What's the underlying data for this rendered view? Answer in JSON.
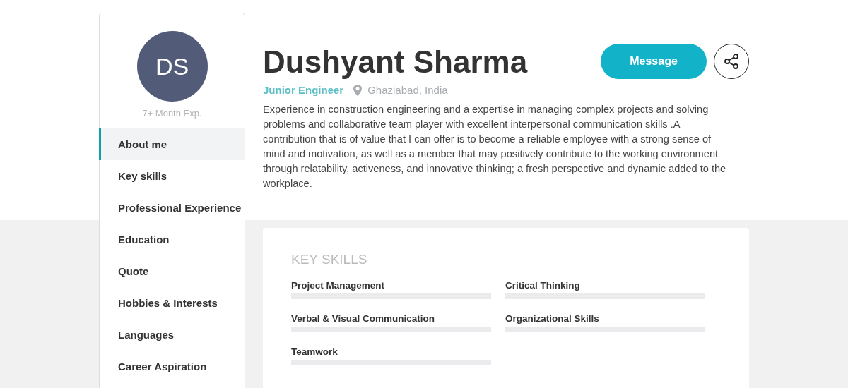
{
  "profile": {
    "initials": "DS",
    "experience": "7+ Month Exp.",
    "name": "Dushyant Sharma",
    "role": "Junior Engineer",
    "location": "Ghaziabad, India",
    "bio": "Experience in construction engineering and a expertise in managing complex projects and solving problems and collaborative team player with excellent interpersonal communication skills .A contribution that is of value that I can offer is to become a reliable employee with a strong sense of mind and motivation, as well as a member that may positively contribute to the working environment through relatability, activeness, and innovative thinking; a fresh perspective and dynamic added to the workplace."
  },
  "actions": {
    "message": "Message"
  },
  "sidebar": {
    "items": [
      {
        "label": "About me",
        "selected": true
      },
      {
        "label": "Key skills",
        "selected": false
      },
      {
        "label": "Professional Experience",
        "selected": false
      },
      {
        "label": "Education",
        "selected": false
      },
      {
        "label": "Quote",
        "selected": false
      },
      {
        "label": "Hobbies & Interests",
        "selected": false
      },
      {
        "label": "Languages",
        "selected": false
      },
      {
        "label": "Career Aspiration",
        "selected": false
      }
    ]
  },
  "key_skills": {
    "title": "KEY SKILLS",
    "skills": [
      {
        "name": "Project Management"
      },
      {
        "name": "Critical Thinking"
      },
      {
        "name": "Verbal & Visual Communication"
      },
      {
        "name": "Organizational Skills"
      },
      {
        "name": "Teamwork"
      }
    ]
  }
}
